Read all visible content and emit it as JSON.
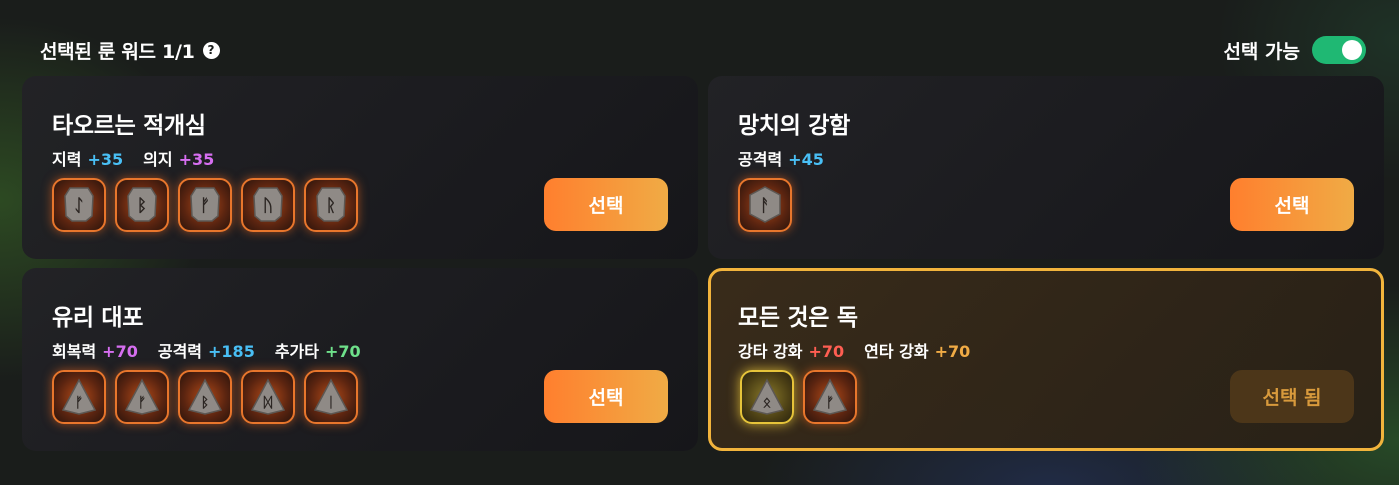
{
  "header": {
    "title": "선택된 룬 워드 1/1",
    "help_glyph": "?",
    "toggle_label": "선택 가능",
    "toggle_on": true
  },
  "colors": {
    "toggle_on": "#1fb873",
    "accent_orange": "#ff7f2e",
    "selected_border": "#f2b43c"
  },
  "rune_words": [
    {
      "title": "타오르는 적개심",
      "stats": [
        {
          "label": "지력",
          "value": "+35",
          "color": "#49bff5"
        },
        {
          "label": "의지",
          "value": "+35",
          "color": "#d66ef0"
        }
      ],
      "runes": [
        {
          "glyph": "ᛇ",
          "tier": "orange",
          "shape": "square"
        },
        {
          "glyph": "ᛒ",
          "tier": "orange",
          "shape": "square"
        },
        {
          "glyph": "ᚠ",
          "tier": "orange",
          "shape": "square"
        },
        {
          "glyph": "ᚢ",
          "tier": "orange",
          "shape": "square"
        },
        {
          "glyph": "ᚱ",
          "tier": "orange",
          "shape": "square"
        }
      ],
      "button_label": "선택",
      "selected": false
    },
    {
      "title": "망치의 강함",
      "stats": [
        {
          "label": "공격력",
          "value": "+45",
          "color": "#49bff5"
        }
      ],
      "runes": [
        {
          "glyph": "ᚨ",
          "tier": "orange",
          "shape": "hexagon"
        }
      ],
      "button_label": "선택",
      "selected": false
    },
    {
      "title": "유리 대포",
      "stats": [
        {
          "label": "회복력",
          "value": "+70",
          "color": "#d66ef0"
        },
        {
          "label": "공격력",
          "value": "+185",
          "color": "#49bff5"
        },
        {
          "label": "추가타",
          "value": "+70",
          "color": "#6ee08a"
        }
      ],
      "runes": [
        {
          "glyph": "ᚠ",
          "tier": "orange",
          "shape": "triangle"
        },
        {
          "glyph": "ᚠ",
          "tier": "orange",
          "shape": "triangle"
        },
        {
          "glyph": "ᛒ",
          "tier": "orange",
          "shape": "triangle"
        },
        {
          "glyph": "ᛞ",
          "tier": "orange",
          "shape": "triangle"
        },
        {
          "glyph": "ᛁ",
          "tier": "orange",
          "shape": "triangle"
        }
      ],
      "button_label": "선택",
      "selected": false
    },
    {
      "title": "모든 것은 독",
      "stats": [
        {
          "label": "강타 강화",
          "value": "+70",
          "color": "#ff5e52"
        },
        {
          "label": "연타 강화",
          "value": "+70",
          "color": "#f0ab45"
        }
      ],
      "runes": [
        {
          "glyph": "ᛟ",
          "tier": "gold",
          "shape": "triangle"
        },
        {
          "glyph": "ᚠ",
          "tier": "orange",
          "shape": "triangle"
        }
      ],
      "button_label": "선택 됨",
      "selected": true
    }
  ]
}
